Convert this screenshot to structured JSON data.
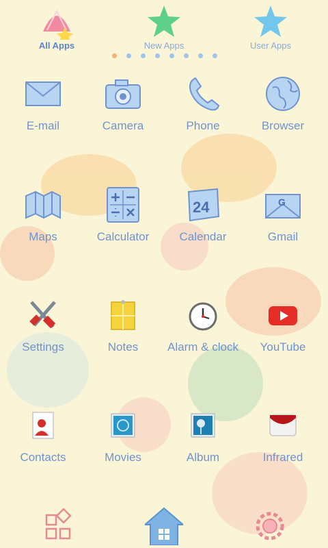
{
  "tabs": [
    {
      "label": "All Apps",
      "icon": "shell-icon",
      "active": true
    },
    {
      "label": "New Apps",
      "icon": "star-icon",
      "active": false
    },
    {
      "label": "User Apps",
      "icon": "star-icon",
      "active": false
    }
  ],
  "pager": {
    "count": 8,
    "active_index": 0
  },
  "apps": [
    {
      "label": "E-mail",
      "icon": "envelope-icon"
    },
    {
      "label": "Camera",
      "icon": "camera-icon"
    },
    {
      "label": "Phone",
      "icon": "phone-icon"
    },
    {
      "label": "Browser",
      "icon": "globe-icon"
    },
    {
      "label": "Maps",
      "icon": "map-icon"
    },
    {
      "label": "Calculator",
      "icon": "calculator-icon"
    },
    {
      "label": "Calendar",
      "icon": "calendar-icon"
    },
    {
      "label": "Gmail",
      "icon": "mail-icon"
    },
    {
      "label": "Settings",
      "icon": "tools-icon"
    },
    {
      "label": "Notes",
      "icon": "notes-icon"
    },
    {
      "label": "Alarm & clock",
      "icon": "clock-icon"
    },
    {
      "label": "YouTube",
      "icon": "play-icon"
    },
    {
      "label": "Contacts",
      "icon": "contact-icon"
    },
    {
      "label": "Movies",
      "icon": "movie-icon"
    },
    {
      "label": "Album",
      "icon": "photo-icon"
    },
    {
      "label": "Infrared",
      "icon": "remote-icon"
    }
  ],
  "dock": [
    {
      "icon": "grid-icon"
    },
    {
      "icon": "home-icon"
    },
    {
      "icon": "gear-icon"
    }
  ],
  "colors": {
    "label": "#6f93cf",
    "accent": "#5b83c7",
    "background": "#fbf5d7"
  }
}
